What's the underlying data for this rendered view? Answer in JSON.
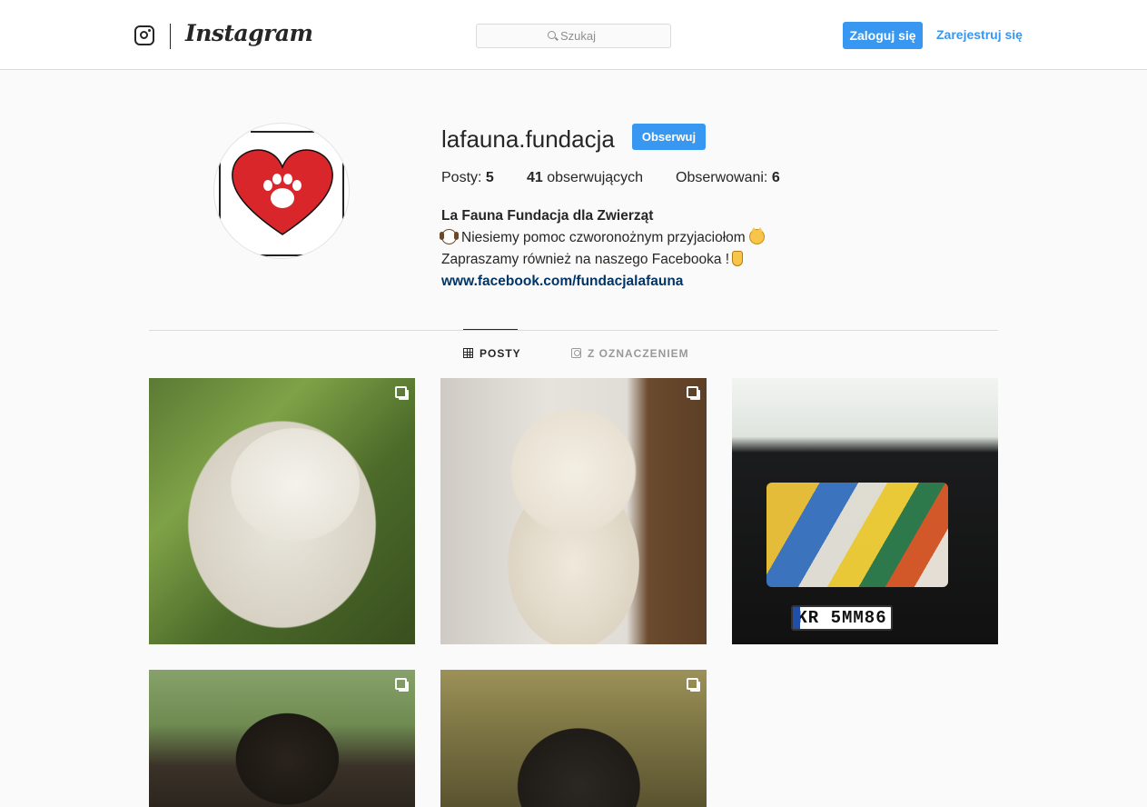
{
  "header": {
    "brand": "Instagram",
    "search_placeholder": "Szukaj",
    "login_label": "Zaloguj się",
    "register_label": "Zarejestruj się"
  },
  "profile": {
    "username": "lafauna.fundacja",
    "follow_label": "Obserwuj",
    "stats": {
      "posts_label": "Posty:",
      "posts_count": "5",
      "followers_count": "41",
      "followers_label": "obserwujących",
      "following_label": "Obserwowani:",
      "following_count": "6"
    },
    "bio": {
      "name": "La Fauna Fundacja dla Zwierząt",
      "line1": "Niesiemy pomoc czworonożnym przyjaciołom",
      "line2": "Zapraszamy również na naszego Facebooka !",
      "link": "www.facebook.com/fundacjalafauna",
      "emoji_line1_start": "dog-face-icon",
      "emoji_line1_end": "cat-face-icon",
      "emoji_line2_end": "pointing-down-icon"
    }
  },
  "tabs": [
    {
      "label": "POSTY",
      "icon": "grid-icon",
      "active": true
    },
    {
      "label": "Z OZNACZENIEM",
      "icon": "tagged-icon",
      "active": false
    }
  ],
  "posts": [
    {
      "subject": "white shaggy dog"
    },
    {
      "subject": "white smiling dog"
    },
    {
      "subject": "car trunk with food bags",
      "plate": "KR 5MM86"
    },
    {
      "subject": "black and tan dog"
    },
    {
      "subject": "old dark dog"
    }
  ],
  "colors": {
    "accent": "#3897f0",
    "link": "#003569",
    "text": "#262626",
    "background": "#fafafa",
    "border": "#dbdbdb",
    "avatar_heart": "#d9262a"
  }
}
